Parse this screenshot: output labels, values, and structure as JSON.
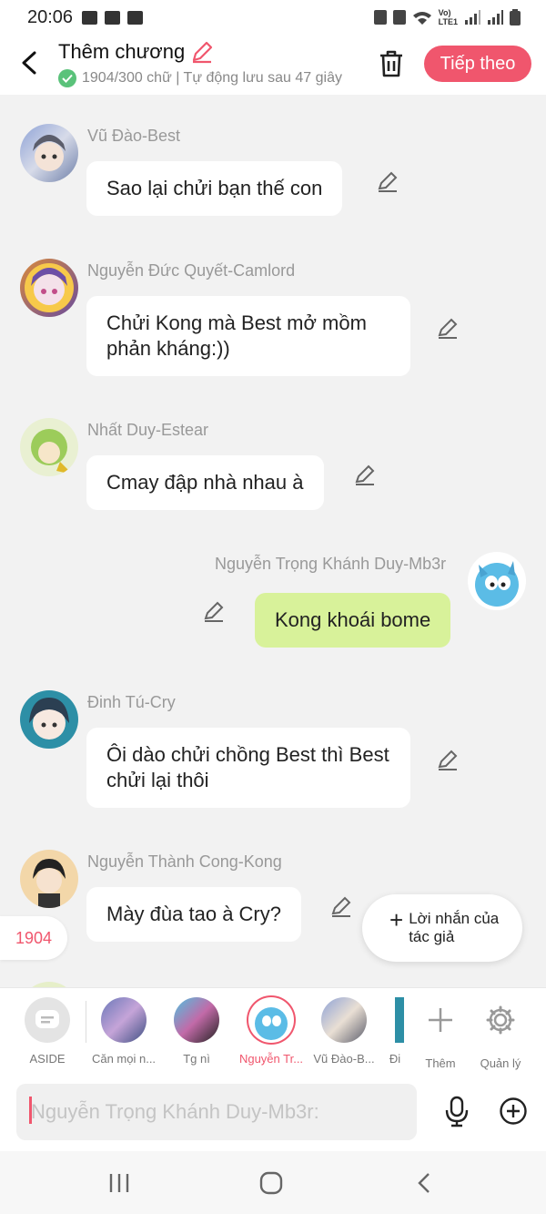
{
  "status": {
    "time": "20:06"
  },
  "header": {
    "title": "Thêm chương",
    "subtitle": "1904/300 chữ | Tự động lưu sau 47 giây",
    "next_label": "Tiếp theo"
  },
  "messages": [
    {
      "author": "Vũ Đào-Best",
      "text": "Sao lại chửi bạn thế con"
    },
    {
      "author": "Nguyễn Đức Quyết-Camlord",
      "text": "Chửi Kong mà Best mở mồm phản kháng:))"
    },
    {
      "author": "Nhất Duy-Estear",
      "text": "Cmay đập nhà nhau à"
    },
    {
      "author": "Nguyễn Trọng Khánh Duy-Mb3r",
      "text": "Kong khoái bome"
    },
    {
      "author": "Đinh Tú-Cry",
      "text": "Ôi dào chửi chồng Best thì Best chửi lại thôi"
    },
    {
      "author": "Nguyễn Thành Cong-Kong",
      "text": "Mày đùa tao à Cry?"
    }
  ],
  "counter": "1904",
  "author_note": {
    "plus": "+",
    "label": "Lời nhắn của tác giả"
  },
  "characters": [
    {
      "label": "ASIDE"
    },
    {
      "label": "Căn mọi n..."
    },
    {
      "label": "Tg nì"
    },
    {
      "label": "Nguyễn Tr..."
    },
    {
      "label": "Vũ Đào-B..."
    },
    {
      "label": "Đi"
    },
    {
      "label": "Thêm"
    },
    {
      "label": "Quản lý"
    }
  ],
  "input": {
    "placeholder": "Nguyễn Trọng Khánh Duy-Mb3r:"
  },
  "colors": {
    "accent": "#f0566d",
    "mine_bubble": "#d8f29a",
    "background": "#f2f2f2"
  }
}
